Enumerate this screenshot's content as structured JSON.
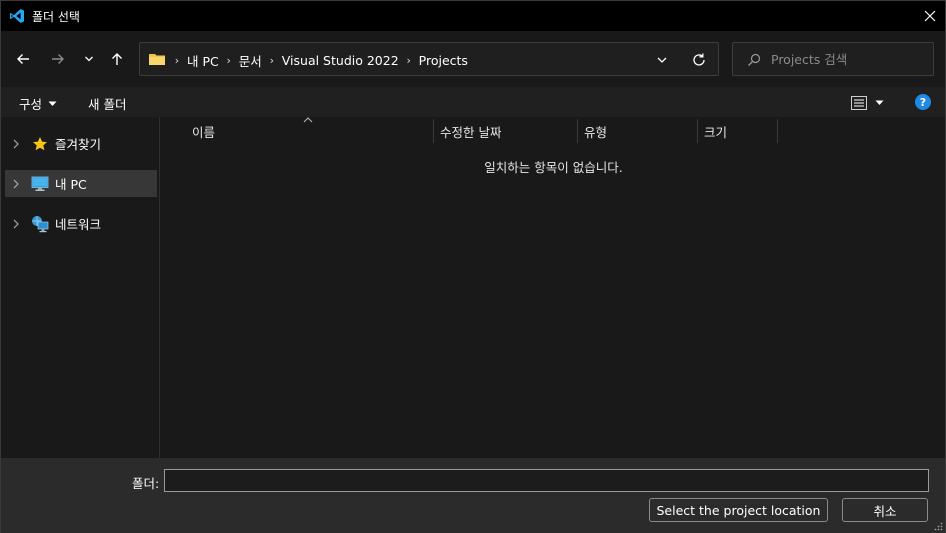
{
  "window": {
    "title": "폴더 선택",
    "accent": "#1e8ae6"
  },
  "address": {
    "crumbs": [
      "내 PC",
      "문서",
      "Visual Studio 2022",
      "Projects"
    ]
  },
  "search": {
    "placeholder": "Projects 검색"
  },
  "toolbar": {
    "organize_label": "구성",
    "new_folder_label": "새 폴더",
    "help_label": "?"
  },
  "sidebar": {
    "items": [
      {
        "label": "즐겨찾기",
        "icon": "star-icon",
        "selected": false
      },
      {
        "label": "내 PC",
        "icon": "pc-icon",
        "selected": true
      },
      {
        "label": "네트워크",
        "icon": "network-icon",
        "selected": false
      }
    ]
  },
  "content": {
    "columns": [
      "이름",
      "수정한 날짜",
      "유형",
      "크기"
    ],
    "empty_message": "일치하는 항목이 없습니다."
  },
  "footer": {
    "folder_label": "폴더:",
    "folder_value": "",
    "select_button": "Select the project location",
    "cancel_button": "취소"
  }
}
